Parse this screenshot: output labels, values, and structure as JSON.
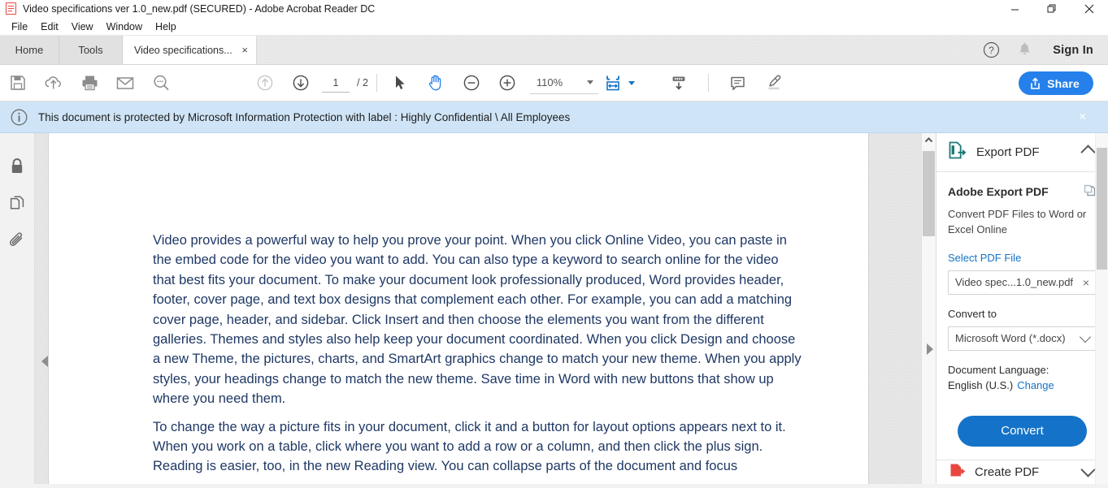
{
  "window": {
    "title": "Video specifications ver 1.0_new.pdf (SECURED) - Adobe Acrobat Reader DC",
    "app_icon": "pdf-document-icon",
    "minimize": "minimize-icon",
    "restore": "restore-icon",
    "close": "close-icon"
  },
  "menu": {
    "items": [
      "File",
      "Edit",
      "View",
      "Window",
      "Help"
    ]
  },
  "tabs": {
    "home": "Home",
    "tools": "Tools",
    "document": "Video specifications...",
    "document_close": "×",
    "help_icon": "help-circle-icon",
    "bell_icon": "notification-bell-icon",
    "sign_in": "Sign In"
  },
  "toolbar": {
    "save": "save-icon",
    "upload_cloud": "upload-to-cloud-icon",
    "print": "print-icon",
    "email": "email-icon",
    "search": "search-icon",
    "prev_page": "previous-page-icon",
    "next_page": "next-page-icon",
    "page_current": "1",
    "page_total": "/ 2",
    "select_tool": "select-cursor-icon",
    "hand_tool": "hand-tool-icon",
    "zoom_out": "zoom-out-icon",
    "zoom_in": "zoom-in-icon",
    "zoom_level": "110%",
    "fit_width": "fit-width-icon",
    "page_display": "page-display-icon",
    "comment": "comment-icon",
    "highlight": "highlighter-icon",
    "share_label": "Share",
    "share_icon": "share-icon",
    "accent_blue": "#2680eb",
    "active_tool_blue": "#1473c8"
  },
  "infobar": {
    "icon": "info-circle-icon",
    "message": "This document is protected by Microsoft Information Protection with label : Highly Confidential \\ All Employees",
    "close": "×",
    "background": "#cfe5f7"
  },
  "leftrail": {
    "items": [
      {
        "name": "security-lock-icon",
        "label": "Security"
      },
      {
        "name": "page-thumbnails-icon",
        "label": "Page Thumbnails"
      },
      {
        "name": "attachments-paperclip-icon",
        "label": "Attachments"
      }
    ],
    "collapse_arrow": "collapse-left-arrow"
  },
  "document": {
    "paragraphs": [
      "Video provides a powerful way to help you prove your point. When you click Online Video, you can paste in the embed code for the video you want to add. You can also type a keyword to search online for the video that best fits your document. To make your document look professionally produced, Word provides header, footer, cover page, and text box designs that complement each other. For example, you can add a matching cover page, header, and sidebar. Click Insert and then choose the elements you want from the different galleries. Themes and styles also help keep your document coordinated. When you click Design and choose a new Theme, the pictures, charts, and SmartArt graphics change to match your new theme. When you apply styles, your headings change to match the new theme. Save time in Word with new buttons that show up where you need them.",
      "To change the way a picture fits in your document, click it and a button for layout options appears next to it. When you work on a table, click where you want to add a row or a column, and then click the plus sign. Reading is easier, too, in the new Reading view. You can collapse parts of the document and focus"
    ],
    "text_color": "#1f3864",
    "expand_arrow": "expand-right-arrow",
    "scroll_up": "scroll-up-arrow"
  },
  "rightpanel": {
    "header_title": "Export PDF",
    "header_icon": "export-pdf-icon",
    "collapse_icon": "chevron-up-icon",
    "section_title": "Adobe Export PDF",
    "section_icon": "copy-icon",
    "section_subtitle": "Convert PDF Files to Word or Excel Online",
    "select_file_label": "Select PDF File",
    "selected_file": "Video spec...1.0_new.pdf",
    "clear_file": "×",
    "convert_to_label": "Convert to",
    "convert_to_value": "Microsoft Word (*.docx)",
    "convert_to_caret": "chevron-down-icon",
    "language_label": "Document Language:",
    "language_value": "English (U.S.)",
    "language_change": "Change",
    "convert_button": "Convert",
    "convert_button_color": "#1473c8",
    "footer_title": "Create PDF",
    "footer_icon": "create-pdf-icon",
    "footer_caret": "chevron-down-icon"
  }
}
